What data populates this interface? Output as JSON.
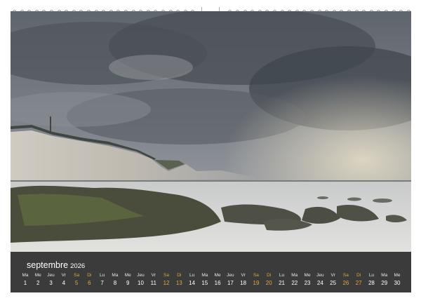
{
  "calendar": {
    "month": "septembre",
    "year": "2026",
    "days": [
      {
        "abbr": "Ma",
        "num": "1",
        "weekend": false
      },
      {
        "abbr": "Me",
        "num": "2",
        "weekend": false
      },
      {
        "abbr": "Jeu",
        "num": "3",
        "weekend": false
      },
      {
        "abbr": "Vr",
        "num": "4",
        "weekend": false
      },
      {
        "abbr": "Sa",
        "num": "5",
        "weekend": true
      },
      {
        "abbr": "Di",
        "num": "6",
        "weekend": true
      },
      {
        "abbr": "Lu",
        "num": "7",
        "weekend": false
      },
      {
        "abbr": "Ma",
        "num": "8",
        "weekend": false
      },
      {
        "abbr": "Me",
        "num": "9",
        "weekend": false
      },
      {
        "abbr": "Jeu",
        "num": "10",
        "weekend": false
      },
      {
        "abbr": "Vr",
        "num": "11",
        "weekend": false
      },
      {
        "abbr": "Sa",
        "num": "12",
        "weekend": true
      },
      {
        "abbr": "Di",
        "num": "13",
        "weekend": true
      },
      {
        "abbr": "Lu",
        "num": "14",
        "weekend": false
      },
      {
        "abbr": "Ma",
        "num": "15",
        "weekend": false
      },
      {
        "abbr": "Me",
        "num": "16",
        "weekend": false
      },
      {
        "abbr": "Jeu",
        "num": "17",
        "weekend": false
      },
      {
        "abbr": "Vr",
        "num": "18",
        "weekend": false
      },
      {
        "abbr": "Sa",
        "num": "19",
        "weekend": true
      },
      {
        "abbr": "Di",
        "num": "20",
        "weekend": true
      },
      {
        "abbr": "Lu",
        "num": "21",
        "weekend": false
      },
      {
        "abbr": "Ma",
        "num": "22",
        "weekend": false
      },
      {
        "abbr": "Me",
        "num": "23",
        "weekend": false
      },
      {
        "abbr": "Jeu",
        "num": "24",
        "weekend": false
      },
      {
        "abbr": "Vr",
        "num": "25",
        "weekend": false
      },
      {
        "abbr": "Sa",
        "num": "26",
        "weekend": true
      },
      {
        "abbr": "Di",
        "num": "27",
        "weekend": true
      },
      {
        "abbr": "Lu",
        "num": "28",
        "weekend": false
      },
      {
        "abbr": "Ma",
        "num": "29",
        "weekend": false
      },
      {
        "abbr": "Me",
        "num": "30",
        "weekend": false
      }
    ]
  },
  "colors": {
    "strip": "#3b3b3b",
    "weekend": "#e0a93a",
    "weekday": "#ffffff"
  }
}
